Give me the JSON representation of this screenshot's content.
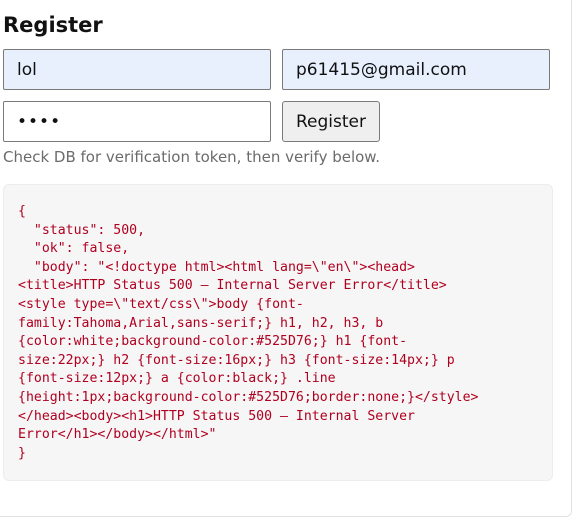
{
  "form": {
    "title": "Register",
    "username_value": "lol",
    "email_value": "p61415@gmail.com",
    "password_value": "••••",
    "submit_label": "Register",
    "hint": "Check DB for verification token, then verify below."
  },
  "response": {
    "lines": [
      "{",
      "  \"status\": 500,",
      "  \"ok\": false,",
      "  \"body\": \"<!doctype html><html lang=\\\"en\\\"><head>",
      "<title>HTTP Status 500 – Internal Server Error</title>",
      "<style type=\\\"text/css\\\">body {font-",
      "family:Tahoma,Arial,sans-serif;} h1, h2, h3, b",
      "{color:white;background-color:#525D76;} h1 {font-",
      "size:22px;} h2 {font-size:16px;} h3 {font-size:14px;} p",
      "{font-size:12px;} a {color:black;} .line",
      "{height:1px;background-color:#525D76;border:none;}</style>",
      "</head><body><h1>HTTP Status 500 – Internal Server",
      "Error</h1></body></html>\"",
      "}"
    ]
  }
}
